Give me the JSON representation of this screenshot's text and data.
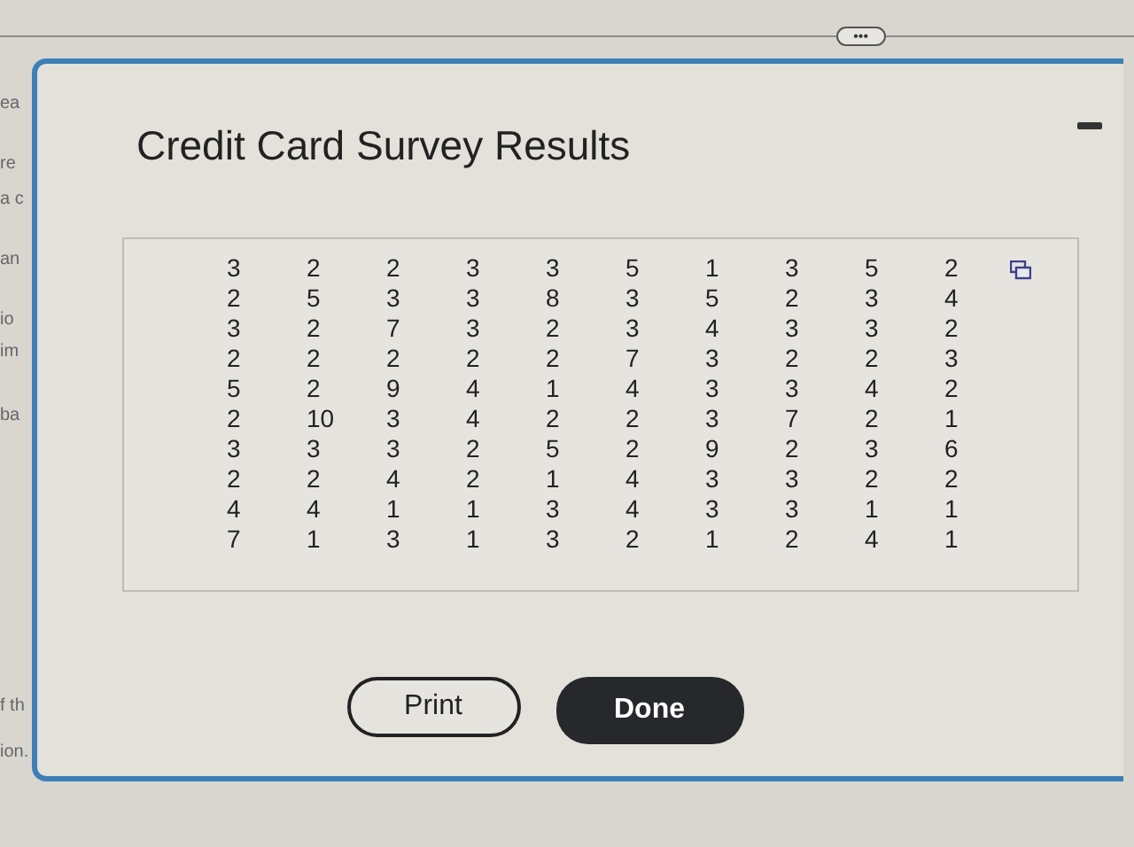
{
  "toolbar": {
    "more_button": "•••"
  },
  "background_fragments": [
    "ea",
    "re",
    "a c",
    "an",
    "io",
    "im",
    "ba",
    "f th",
    "ion."
  ],
  "dialog": {
    "title": "Credit Card Survey Results",
    "table": {
      "rows": [
        [
          "3",
          "2",
          "2",
          "3",
          "3",
          "5",
          "1",
          "3",
          "5",
          "2"
        ],
        [
          "2",
          "5",
          "3",
          "3",
          "8",
          "3",
          "5",
          "2",
          "3",
          "4"
        ],
        [
          "3",
          "2",
          "7",
          "3",
          "2",
          "3",
          "4",
          "3",
          "3",
          "2"
        ],
        [
          "2",
          "2",
          "2",
          "2",
          "2",
          "7",
          "3",
          "2",
          "2",
          "3"
        ],
        [
          "5",
          "2",
          "9",
          "4",
          "1",
          "4",
          "3",
          "3",
          "4",
          "2"
        ],
        [
          "2",
          "10",
          "3",
          "4",
          "2",
          "2",
          "3",
          "7",
          "2",
          "1"
        ],
        [
          "3",
          "3",
          "3",
          "2",
          "5",
          "2",
          "9",
          "2",
          "3",
          "6"
        ],
        [
          "2",
          "2",
          "4",
          "2",
          "1",
          "4",
          "3",
          "3",
          "2",
          "2"
        ],
        [
          "4",
          "4",
          "1",
          "1",
          "3",
          "4",
          "3",
          "3",
          "1",
          "1"
        ],
        [
          "7",
          "1",
          "3",
          "1",
          "3",
          "2",
          "1",
          "2",
          "4",
          "1"
        ]
      ]
    },
    "buttons": [
      {
        "label": "Print",
        "kind": "secondary"
      },
      {
        "label": "Done",
        "kind": "primary"
      }
    ]
  }
}
